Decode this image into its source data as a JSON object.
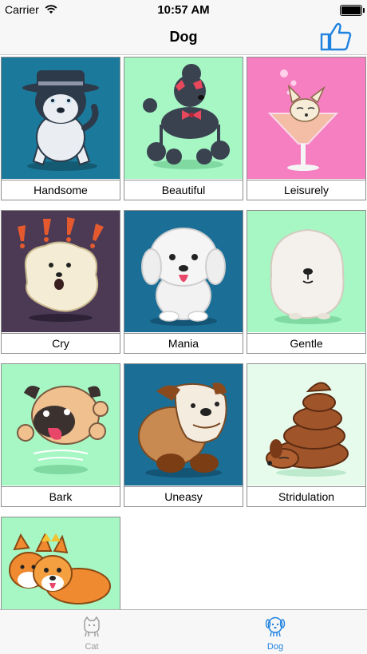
{
  "status_bar": {
    "carrier": "Carrier",
    "time": "10:57 AM"
  },
  "nav": {
    "title": "Dog",
    "right_icon": "thumbs-up-icon"
  },
  "tiles": [
    {
      "label": "Handsome",
      "bg": "#1b7a9b"
    },
    {
      "label": "Beautiful",
      "bg": "#a6f7c4"
    },
    {
      "label": "Leisurely",
      "bg": "#f57fc0"
    },
    {
      "label": "Cry",
      "bg": "#4c3a55"
    },
    {
      "label": "Mania",
      "bg": "#1b6e96"
    },
    {
      "label": "Gentle",
      "bg": "#a6f7c4"
    },
    {
      "label": "Bark",
      "bg": "#a6f7c4"
    },
    {
      "label": "Uneasy",
      "bg": "#1b6e96"
    },
    {
      "label": "Stridulation",
      "bg": "#e6fbec"
    },
    {
      "label": "",
      "bg": "#a6f7c4"
    }
  ],
  "tabs": [
    {
      "label": "Cat",
      "icon": "cat-icon",
      "active": false
    },
    {
      "label": "Dog",
      "icon": "dog-icon",
      "active": true
    }
  ],
  "colors": {
    "accent": "#1f82e0",
    "inactive": "#9a9a9a"
  }
}
